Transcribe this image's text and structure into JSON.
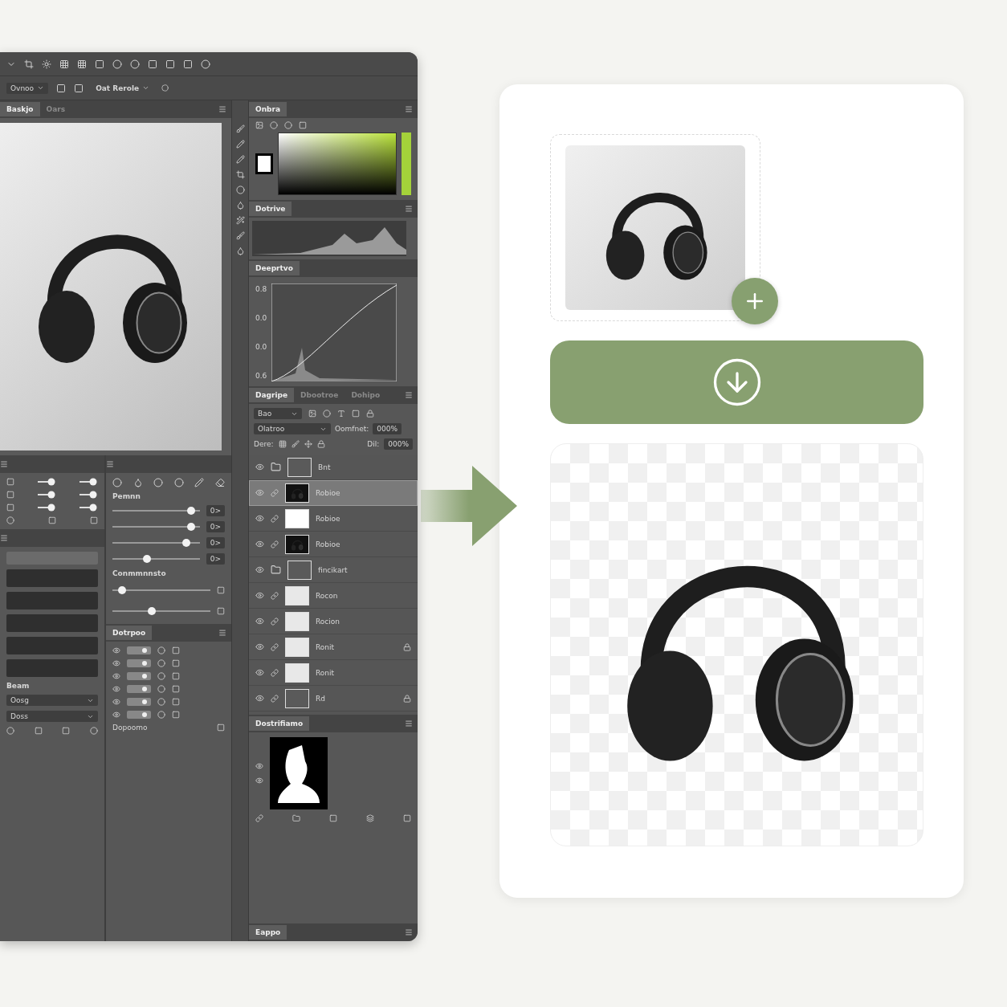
{
  "options_bar": {
    "preset": "Ovnoo",
    "mode": "Oat Rerole"
  },
  "document": {
    "tabs": [
      {
        "label": "Baskjo",
        "selected": true
      },
      {
        "label": "Oars",
        "selected": false
      }
    ]
  },
  "color_panel": {
    "tabs": [
      {
        "label": "Onbra",
        "selected": true
      }
    ]
  },
  "histogram_panel": {
    "title": "Dotrive"
  },
  "curves_panel": {
    "title": "Deeprtvo",
    "y_labels": [
      "0.8",
      "0.0",
      "0.0",
      "0.6"
    ]
  },
  "properties_panel": {
    "title": "Pemnn",
    "section": "Conmmnnsto",
    "sliders": [
      {
        "level": 0.9,
        "reading": "0>"
      },
      {
        "level": 0.9,
        "reading": "0>"
      },
      {
        "level": 0.85,
        "reading": "0>"
      },
      {
        "level": 0.4,
        "reading": "0>"
      }
    ],
    "sub_sliders": [
      {
        "level": 0.1
      },
      {
        "level": 0.4
      }
    ]
  },
  "styles_panel": {
    "title": "Dotrpoo",
    "footer": "Dopoomo"
  },
  "left_bottom_panel": {
    "title": "Beam",
    "fields": [
      "Oosg",
      "Doss"
    ]
  },
  "layers_panel": {
    "tabs": [
      {
        "label": "Dagripe",
        "selected": true
      },
      {
        "label": "Dbootroe",
        "selected": false
      },
      {
        "label": "Dohipo",
        "selected": false
      }
    ],
    "filter": "Bao",
    "blend": "Olatroo",
    "opacity_label": "Oomfnet:",
    "opacity": "000%",
    "lock_label": "Dere:",
    "fill_label": "Dil:",
    "fill": "000%",
    "layers": [
      {
        "name": "Bnt",
        "kind": "group",
        "selected": false,
        "locked": false
      },
      {
        "name": "Robioe",
        "kind": "mask",
        "selected": true,
        "locked": false
      },
      {
        "name": "Robioe",
        "kind": "white",
        "selected": false,
        "locked": false
      },
      {
        "name": "Robioe",
        "kind": "mask",
        "selected": false,
        "locked": false
      },
      {
        "name": "fincikart",
        "kind": "group",
        "selected": false,
        "locked": false
      },
      {
        "name": "Rocon",
        "kind": "image",
        "selected": false,
        "locked": false
      },
      {
        "name": "Rocion",
        "kind": "image",
        "selected": false,
        "locked": false
      },
      {
        "name": "Ronit",
        "kind": "image",
        "selected": false,
        "locked": true
      },
      {
        "name": "Ronit",
        "kind": "image",
        "selected": false,
        "locked": false
      },
      {
        "name": "Rd",
        "kind": "adjust",
        "selected": false,
        "locked": true
      }
    ]
  },
  "channels_panel": {
    "title": "Dostrifiamo"
  },
  "bottom_tab": {
    "label": "Eappo"
  }
}
